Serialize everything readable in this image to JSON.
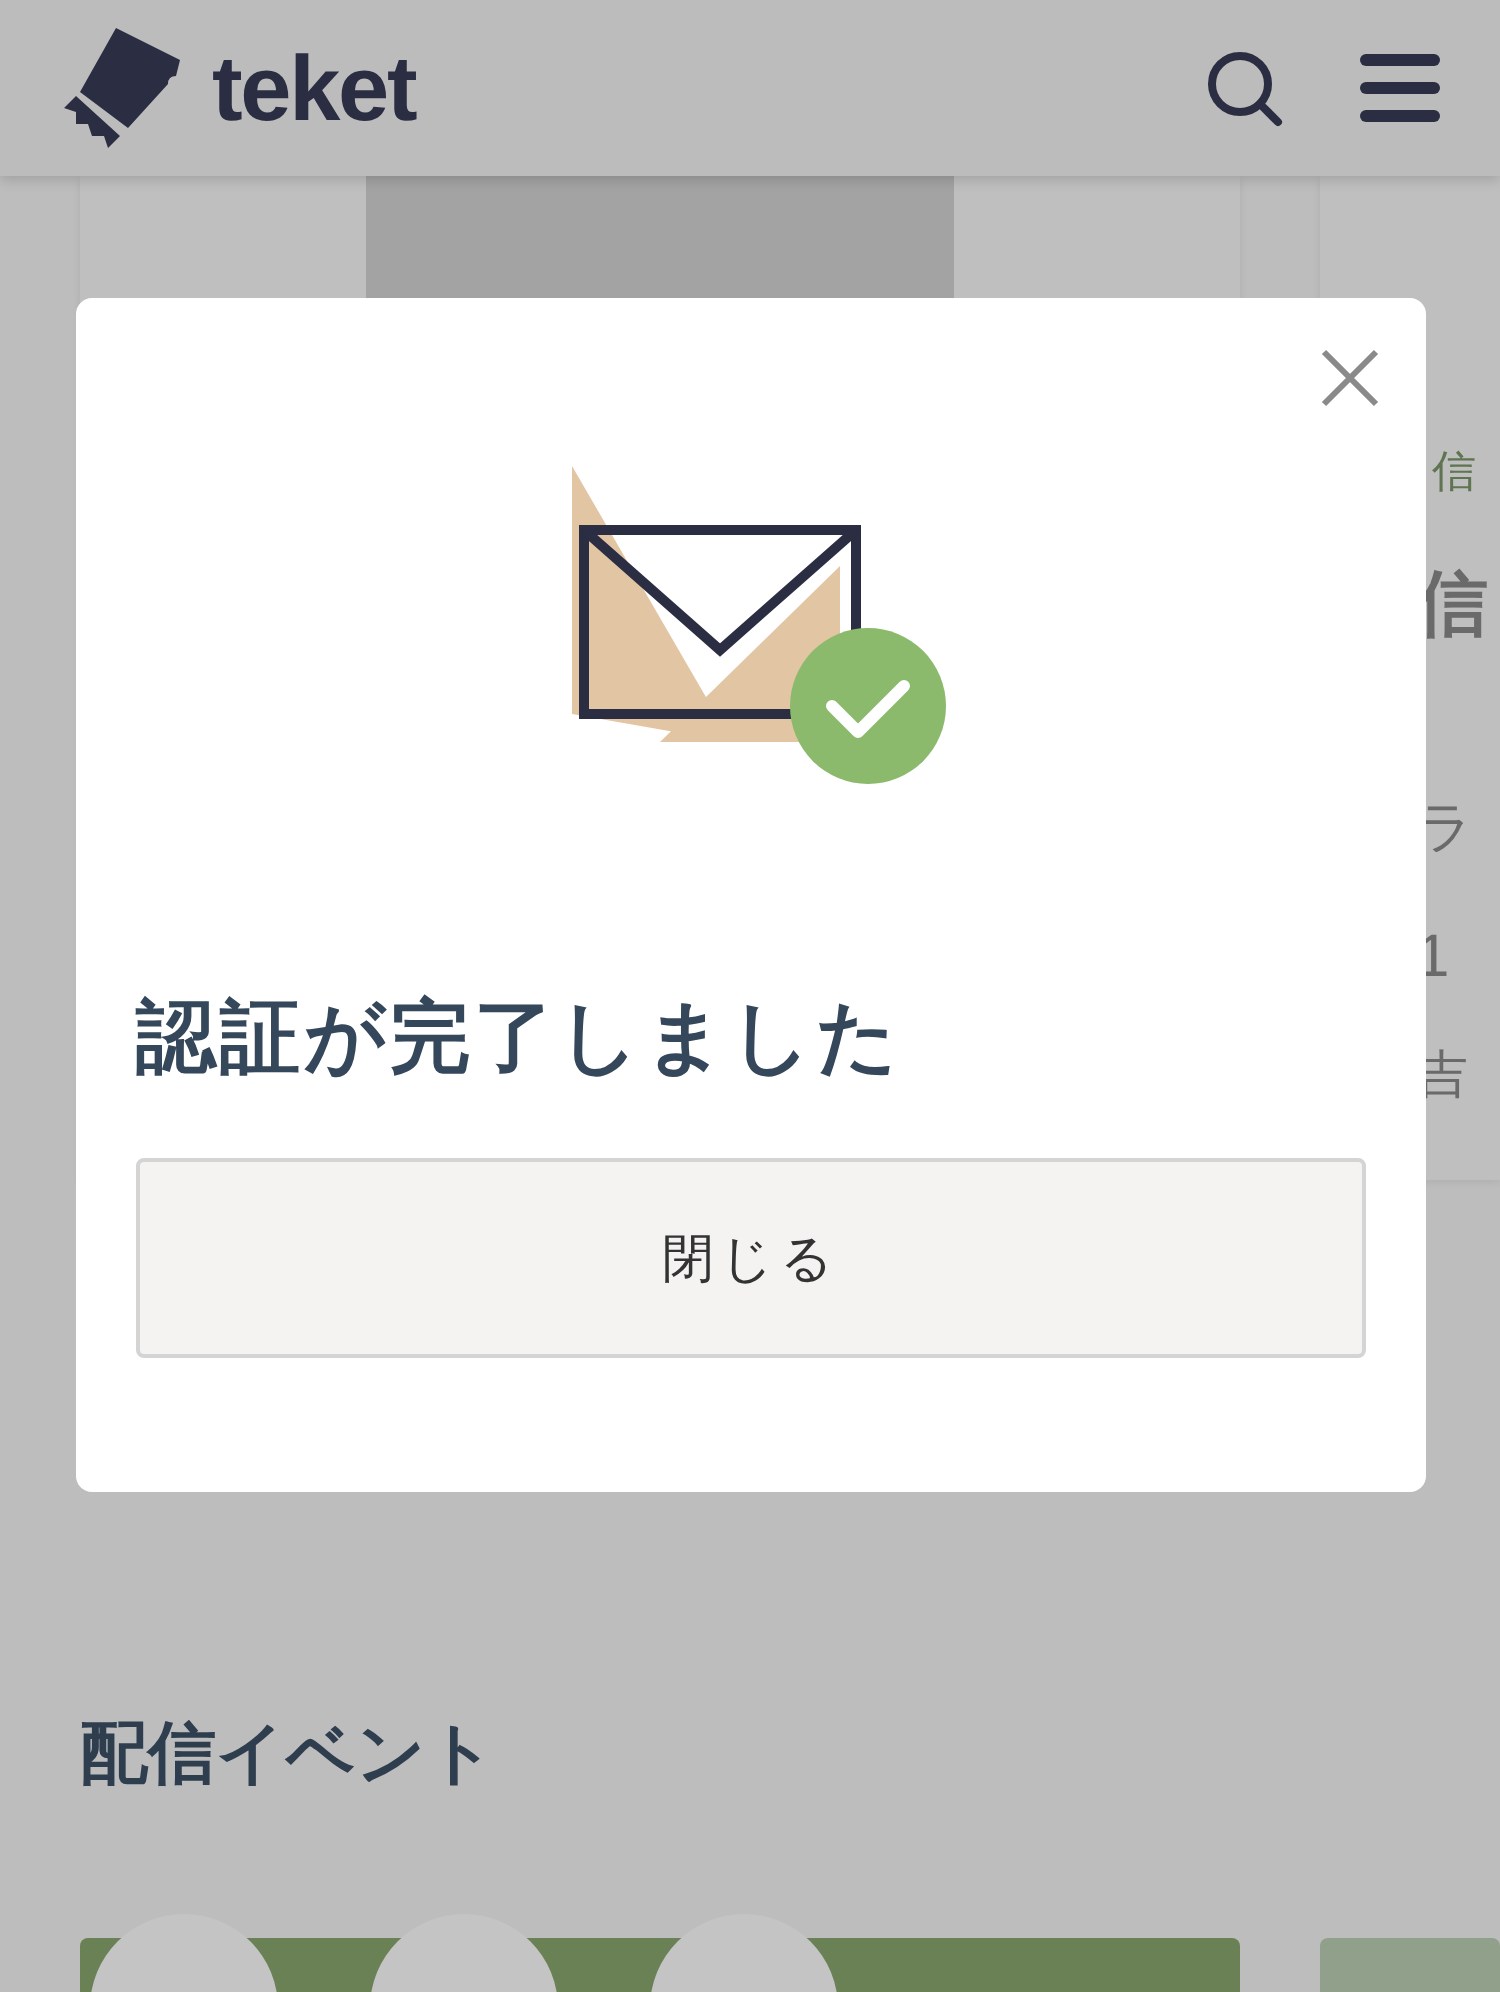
{
  "header": {
    "logo_text": "teket"
  },
  "background_card": {
    "category": "信",
    "title": "信",
    "line_1": "ラ",
    "count": "1",
    "organizer": "吉"
  },
  "section": {
    "title": "配信イベント"
  },
  "dialog": {
    "title": "認証が完了しました",
    "close_button": "閉じる"
  }
}
